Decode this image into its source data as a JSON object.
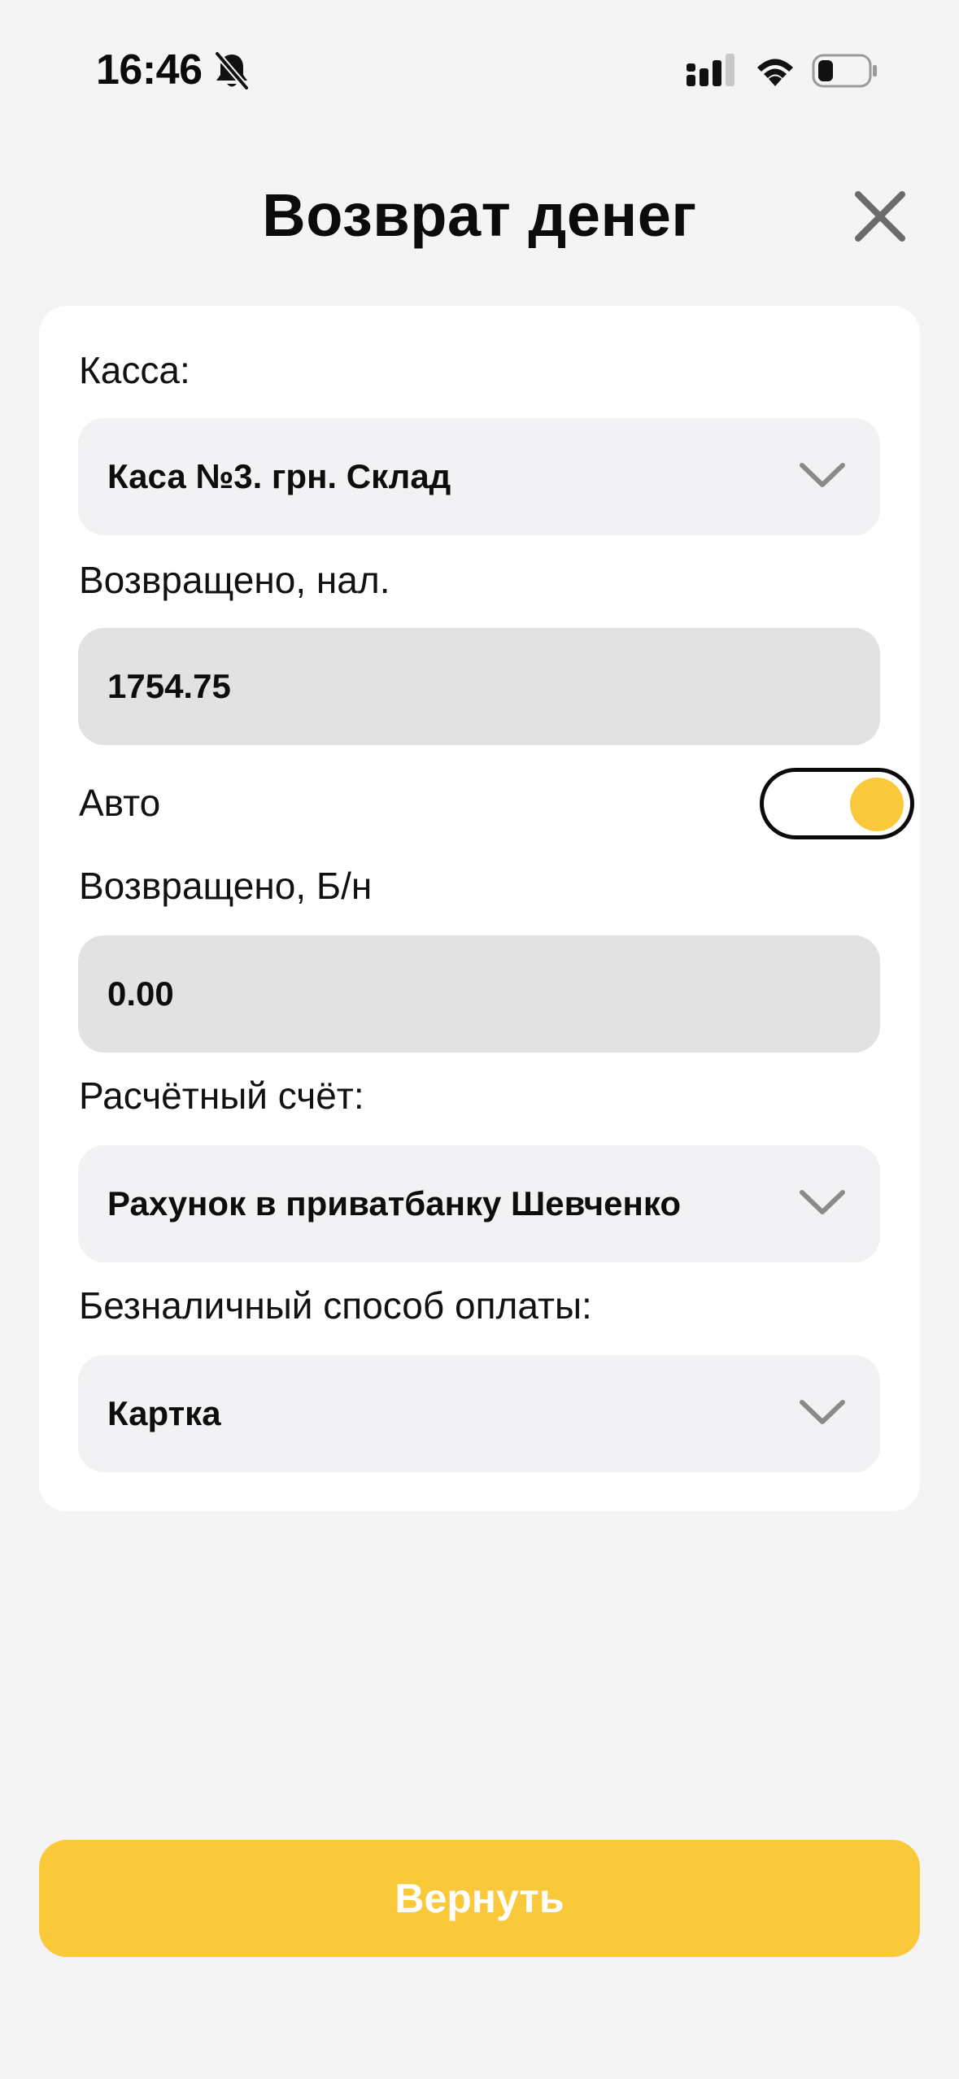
{
  "status_bar": {
    "time": "16:46",
    "icons": [
      "bell-slash-icon",
      "cellular-signal-icon",
      "wifi-icon",
      "battery-icon"
    ]
  },
  "header": {
    "title": "Возврат денег",
    "close_icon": "close-icon"
  },
  "form": {
    "cash_register": {
      "label": "Касса:",
      "value": "Каса №3. грн. Склад"
    },
    "returned_cash": {
      "label": "Возвращено, нал.",
      "value": "1754.75"
    },
    "auto": {
      "label": "Авто",
      "enabled": true
    },
    "returned_cashless": {
      "label": "Возвращено, Б/н",
      "value": "0.00"
    },
    "account": {
      "label": "Расчётный счёт:",
      "value": "Рахунок в приватбанку Шевченко"
    },
    "payment_method": {
      "label": "Безналичный способ оплаты:",
      "value": "Картка"
    }
  },
  "actions": {
    "submit_label": "Вернуть"
  },
  "colors": {
    "accent": "#fac93a",
    "background": "#f4f4f5",
    "card": "#ffffff",
    "field": "#f2f2f4",
    "field_readonly": "#e2e2e2"
  }
}
